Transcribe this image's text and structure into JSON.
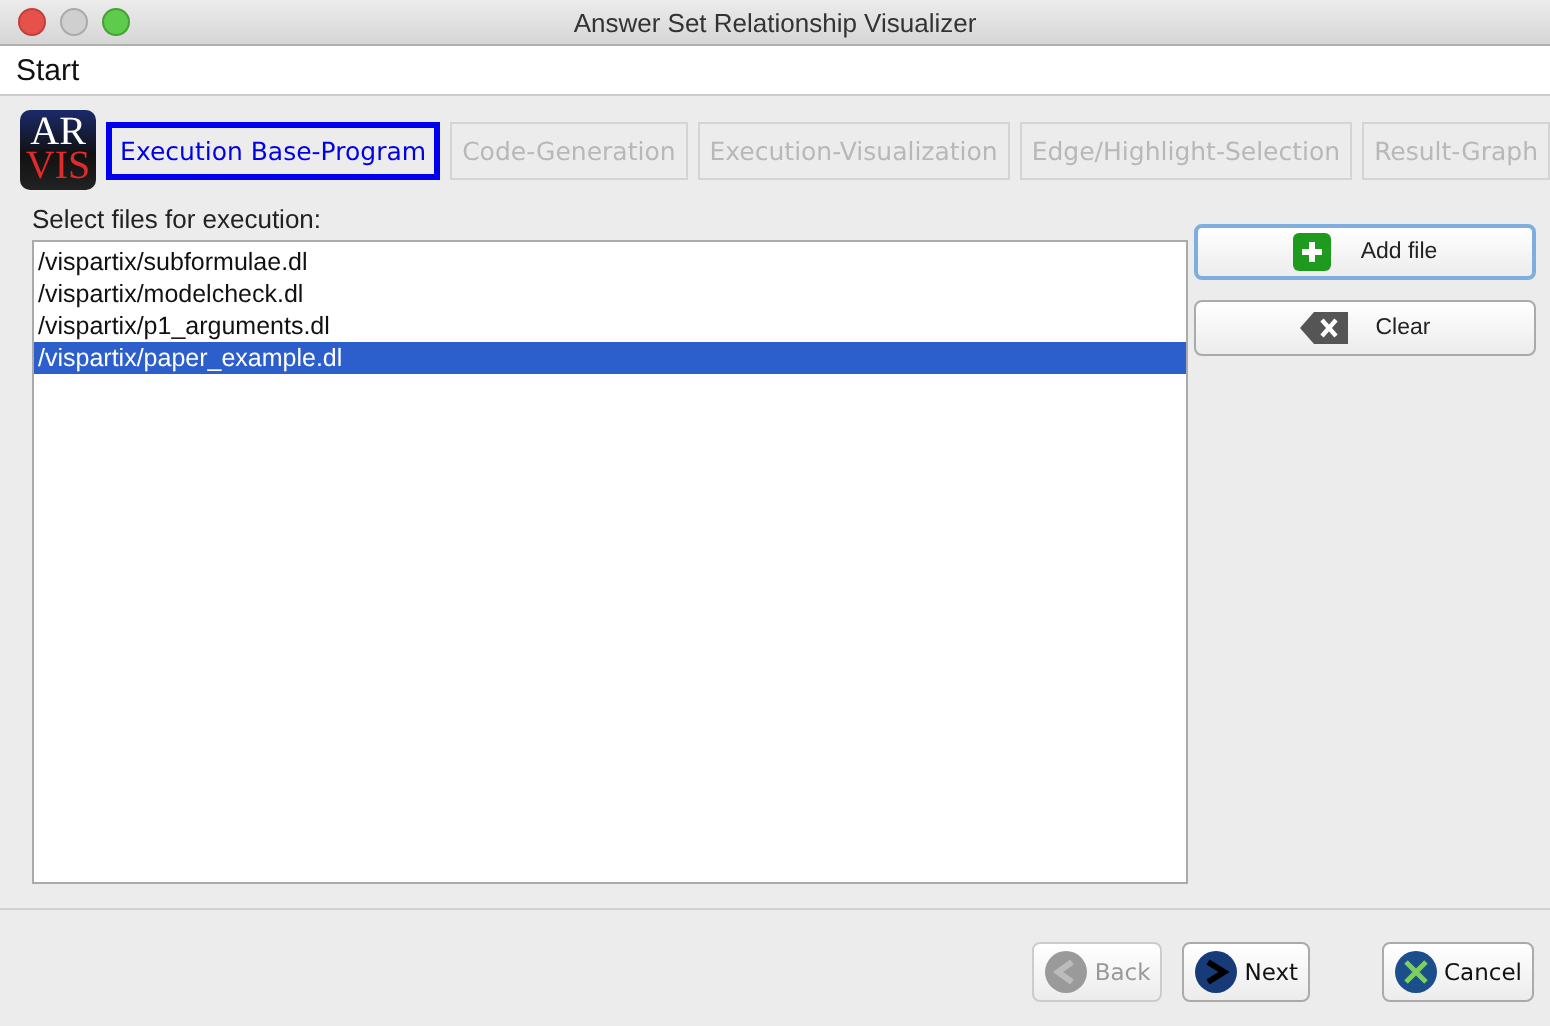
{
  "window": {
    "title": "Answer Set Relationship Visualizer"
  },
  "menu_bar": [
    "Start"
  ],
  "logo": {
    "top": "AR",
    "bottom": "VIS"
  },
  "tabs": [
    {
      "label": "Execution Base-Program",
      "selected": true,
      "disabled": false
    },
    {
      "label": "Code-Generation",
      "selected": false,
      "disabled": true
    },
    {
      "label": "Execution-Visualization",
      "selected": false,
      "disabled": true
    },
    {
      "label": "Edge/Highlight-Selection",
      "selected": false,
      "disabled": true
    },
    {
      "label": "Result-Graph",
      "selected": false,
      "disabled": true
    }
  ],
  "files_label": "Select files for execution:",
  "files": [
    {
      "path": "/vispartix/subformulae.dl",
      "selected": false
    },
    {
      "path": "/vispartix/modelcheck.dl",
      "selected": false
    },
    {
      "path": "/vispartix/p1_arguments.dl",
      "selected": false
    },
    {
      "path": "/vispartix/paper_example.dl",
      "selected": true
    }
  ],
  "side_buttons": [
    {
      "label": "Add file",
      "kind": "add",
      "focused": true
    },
    {
      "label": "Clear",
      "kind": "clear",
      "focused": false
    }
  ],
  "nav_buttons": [
    {
      "label": "Back",
      "kind": "back",
      "disabled": true
    },
    {
      "label": "Next",
      "kind": "next",
      "disabled": false
    },
    {
      "label": "Cancel",
      "kind": "cancel",
      "disabled": false
    }
  ]
}
